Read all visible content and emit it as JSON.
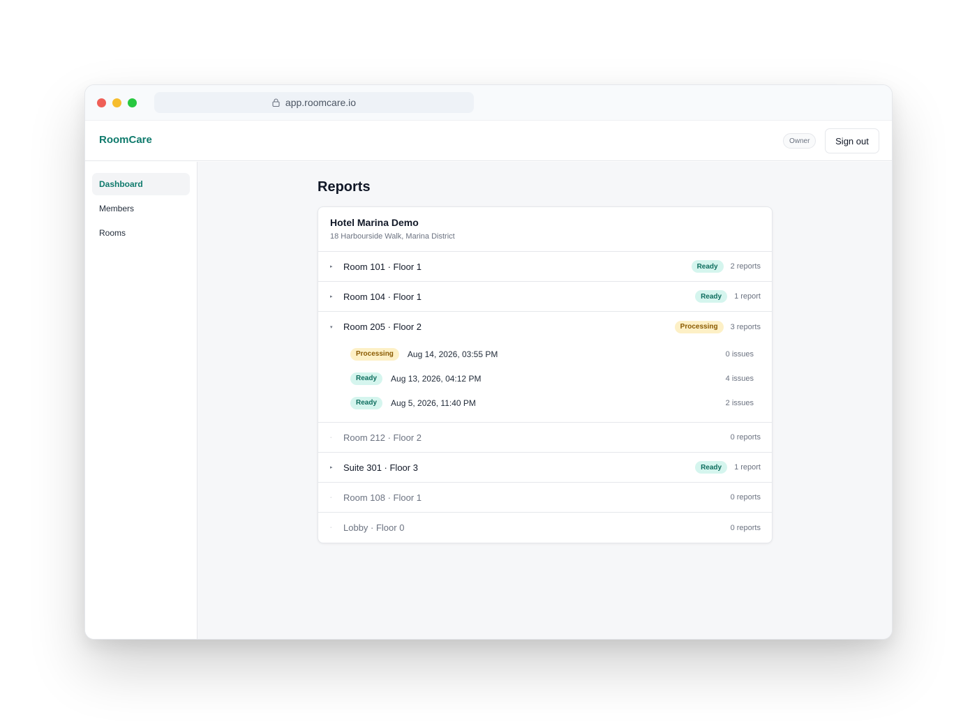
{
  "browser": {
    "url": "app.roomcare.io"
  },
  "app": {
    "brand": "RoomCare",
    "role": "Owner",
    "signout_label": "Sign out"
  },
  "sidebar": {
    "items": [
      {
        "label": "Dashboard",
        "active": true
      },
      {
        "label": "Members",
        "active": false
      },
      {
        "label": "Rooms",
        "active": false
      }
    ]
  },
  "page": {
    "title": "Reports"
  },
  "property": {
    "name": "Hotel Marina Demo",
    "address": "18 Harbourside Walk, Marina District"
  },
  "rooms": [
    {
      "name": "Room 101 · Floor 1",
      "status": "Ready",
      "count": "2 reports",
      "caret": "▸"
    },
    {
      "name": "Room 104 · Floor 1",
      "status": "Ready",
      "count": "1 report",
      "caret": "▸"
    },
    {
      "name": "Room 205 · Floor 2",
      "status": "Processing",
      "count": "3 reports",
      "caret": "▾",
      "reports": [
        {
          "status": "Processing",
          "date": "Aug 14, 2026, 03:55 PM",
          "issues": "0 issues"
        },
        {
          "status": "Ready",
          "date": "Aug 13, 2026, 04:12 PM",
          "issues": "4 issues"
        },
        {
          "status": "Ready",
          "date": "Aug 5, 2026, 11:40 PM",
          "issues": "2 issues"
        }
      ]
    },
    {
      "name": "Room 212 · Floor 2",
      "count": "0 reports",
      "caret": "·"
    },
    {
      "name": "Suite 301 · Floor 3",
      "status": "Ready",
      "count": "1 report",
      "caret": "▸"
    },
    {
      "name": "Room 108 · Floor 1",
      "count": "0 reports",
      "caret": "·"
    },
    {
      "name": "Lobby · Floor 0",
      "count": "0 reports",
      "caret": "·"
    }
  ],
  "colors": {
    "brand": "#0f7a6c",
    "ready_bg": "#d5f5ee",
    "processing_bg": "#fdf0c6"
  }
}
